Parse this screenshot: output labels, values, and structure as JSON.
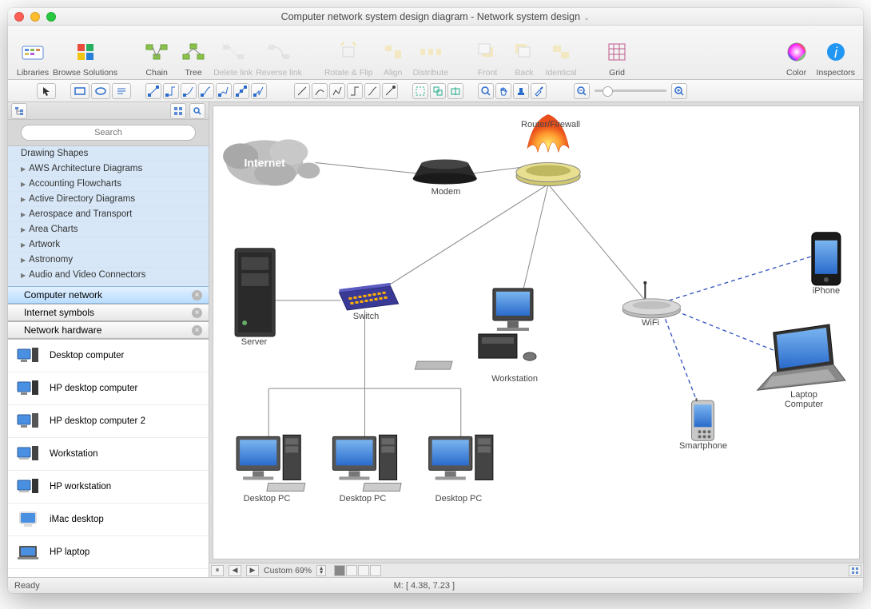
{
  "title": "Computer network system design diagram - Network system design",
  "toolbar": {
    "libraries": "Libraries",
    "browse_solutions": "Browse Solutions",
    "chain": "Chain",
    "tree": "Tree",
    "delete_link": "Delete link",
    "reverse_link": "Reverse link",
    "rotate_flip": "Rotate & Flip",
    "align": "Align",
    "distribute": "Distribute",
    "front": "Front",
    "back": "Back",
    "identical": "Identical",
    "grid": "Grid",
    "color": "Color",
    "inspectors": "Inspectors"
  },
  "search": {
    "placeholder": "Search"
  },
  "categories": [
    "Drawing Shapes",
    "AWS Architecture Diagrams",
    "Accounting Flowcharts",
    "Active Directory Diagrams",
    "Aerospace and Transport",
    "Area Charts",
    "Artwork",
    "Astronomy",
    "Audio and Video Connectors"
  ],
  "open_libs": [
    {
      "name": "Computer network",
      "active": true
    },
    {
      "name": "Internet symbols",
      "active": false
    },
    {
      "name": "Network hardware",
      "active": false
    }
  ],
  "shapes": [
    "Desktop computer",
    "HP desktop computer",
    "HP desktop computer 2",
    "Workstation",
    "HP workstation",
    "iMac desktop",
    "HP laptop"
  ],
  "diagram": {
    "internet": "Internet",
    "modem": "Modem",
    "router_firewall": "Router/Firewall",
    "server": "Server",
    "switch": "Switch",
    "workstation": "Workstation",
    "wifi": "WiFi",
    "iphone": "iPhone",
    "laptop": "Laptop Computer",
    "smartphone": "Smartphone",
    "desktop_pc": "Desktop PC"
  },
  "pagebar": {
    "zoom_label": "Custom 69%"
  },
  "statusbar": {
    "ready": "Ready",
    "mouse": "M: [ 4.38, 7.23 ]"
  }
}
